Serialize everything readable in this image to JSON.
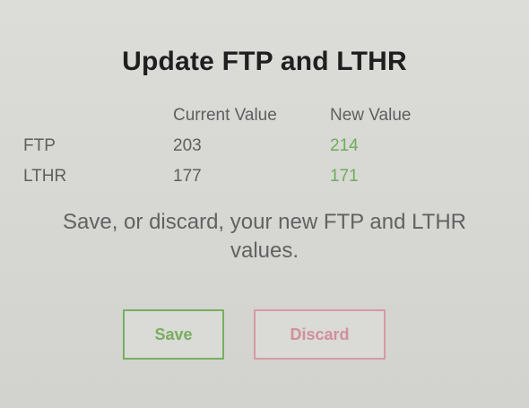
{
  "dialog": {
    "title": "Update FTP and LTHR",
    "columns": {
      "current": "Current Value",
      "new": "New Value"
    },
    "rows": [
      {
        "label": "FTP",
        "current": "203",
        "new": "214"
      },
      {
        "label": "LTHR",
        "current": "177",
        "new": "171"
      }
    ],
    "message": "Save, or discard, your new FTP and LTHR values.",
    "buttons": {
      "save": "Save",
      "discard": "Discard"
    },
    "colors": {
      "save_accent": "#76b060",
      "discard_accent": "#d69aa2",
      "new_value": "#6cae5a",
      "background": "#d6d6d2"
    }
  }
}
